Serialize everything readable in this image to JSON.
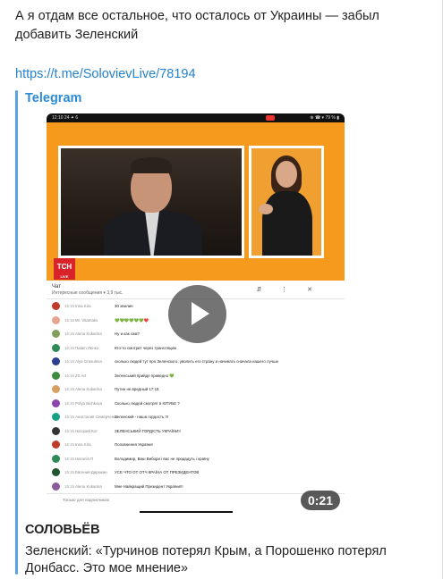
{
  "message": {
    "text": "А я отдам все остальное, что осталось от Украины — забыл добавить Зеленский",
    "link": "https://t.me/SolovievLive/78194"
  },
  "preview": {
    "site_name": "Telegram",
    "author": "СОЛОВЬЁВ",
    "caption": "Зеленский: «Турчинов потерял Крым, а Порошенко потерял Донбасс. Это мое мнение»",
    "duration": "0:21"
  },
  "video_frame": {
    "status_left": "12:10  24 ✦ 6",
    "status_right": "⊕ ☎ ▾ 79 % ▮",
    "channel_logo": "ТСН",
    "channel_sub": "LIVE",
    "chat_title": "Чат",
    "chat_subtitle": "Интересные сообщения  ▾  3,9 тыс.",
    "chat_controls": "⇵ ⋮ ✕",
    "chat_input_placeholder": "Только для подписчиков",
    "chat_rows": [
      {
        "time": "16:15",
        "name": "Inna Kira",
        "text": "30 хвилин",
        "color": "#c0392b"
      },
      {
        "time": "16:15",
        "name": "Mr. Vitamaks",
        "text": "💚💚💚💚💚💚❤️",
        "color": "#e6a58c"
      },
      {
        "time": "16:15",
        "name": "Alena Kukarina",
        "text": "Ну и как сам?",
        "color": "#7f9f5a"
      },
      {
        "time": "16:15",
        "name": "Павел Ленко",
        "text": "Кто-то смотрит через трансляцию",
        "color": "#2e8b57"
      },
      {
        "time": "16:15",
        "name": "Alya Grasuleva",
        "text": "сколько людей тут про Зеленского, уволить его страну и начинать сначала нашего лучше",
        "color": "#2c3e91"
      },
      {
        "time": "16:15",
        "name": "ZS Art",
        "text": "Зеленський прийде праведно 💚",
        "color": "#3c8d3c"
      },
      {
        "time": "16:15",
        "name": "Alena Kukarina",
        "text": "Путин не вредный 17:15",
        "color": "#d6a062"
      },
      {
        "time": "16:15",
        "name": "Polya Bichkova",
        "text": "Сколько людей смотрят в ЮТУБЕ ?",
        "color": "#8e44ad"
      },
      {
        "time": "16:15",
        "name": "Анастасия Семерченко",
        "text": "Зеленский - наша гордость !!!",
        "color": "#16a085"
      },
      {
        "time": "16:15",
        "name": "Нагорий Кот",
        "text": "ЗЕЛЕНСЬКИЙ ГОРДІСТЬ УКРАЇНИ!!",
        "color": "#333333"
      },
      {
        "time": "16:15",
        "name": "Inna Kira",
        "text": "Поповнення України!",
        "color": "#c0392b"
      },
      {
        "time": "16:15",
        "name": "Наталія П",
        "text": "Володимир, Ваш Вибори і вас не продадуть і країну",
        "color": "#2e8b57"
      },
      {
        "time": "16:15",
        "name": "Евгений Дирюкин",
        "text": "УСЕ ЧТО ОТ ОТЧ КРАЇНА ОТ ПРЕЗИДЕНТОВ",
        "color": "#1e5631"
      },
      {
        "time": "16:15",
        "name": "Alena Kukarina",
        "text": "Мне Найкращий Президент України!!!",
        "color": "#8b5a9c"
      }
    ]
  },
  "colors": {
    "accent_link": "#2481cc",
    "preview_bar": "#5aa3df",
    "video_bg_orange": "#f59a1d"
  }
}
